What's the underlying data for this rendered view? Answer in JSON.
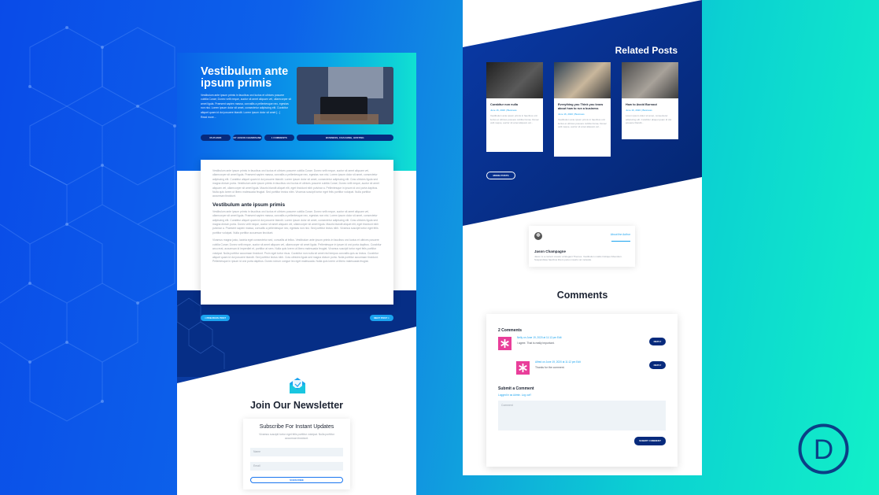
{
  "colors": {
    "brand_dark": "#072a7c",
    "accent_blue": "#1aa3ef",
    "pink_avatar": "#e93e9a",
    "divi_logo": "#0b3f86"
  },
  "left_page": {
    "hero": {
      "title": "Vestibulum ante ipsum primis",
      "text": "Vestibulum ante ipsum primis in faucibus orci luctus et ultrices posuere cubilia Curae; Donec velit neque, auctor sit amet aliquam vel, ullamcorper sit amet ligula. Praesent sapien massa, convallis a pellentesque nec, egestas non nisi. Lorem ipsum dolor sit amet, consectetur adipiscing elit. Curabitur aliquet quam id dui posuere blandit. Lorem ipsum dolor sit amet [...]",
      "read_more": "Read more..."
    },
    "meta": [
      "05.25.2020",
      "BY JASON CHAMPAGNE",
      "1 COMMENTS",
      "BUSINESS, COACHING, HOSTING"
    ],
    "article": {
      "para1": "Vestibulum ante ipsum primis in faucibus orci luctus et ultrices posuere cubilia Curae; Donec velit neque, auctor sit amet aliquam vel, ullamcorper sit amet ligula. Praesent sapien massa, convallis a pellentesque nec, egestas non nisi. Lorem ipsum dolor sit amet, consectetur adipiscing elit. Curabitur aliquet quam id dui posuere blandit. Lorem ipsum dolor sit amet, consectetur adipiscing elit. Cras ultricies ligula sed magna dictum porta. Vestibulum ante ipsum primis in faucibus orci luctus et ultrices posuere cubilia Curae; Donec velit neque, auctor sit amet aliquam vel, ullamcorper sit amet ligula. Mauris blandit aliquet elit, eget tincidunt nibh pulvinar a. Pellentesque in ipsum id orci porta dapibus. Nulla quis lorem ut libero malesuada feugiat. Sed porttitor lectus nibh. Vivamus suscipit tortor eget felis porttitor volutpat. Nulla porttitor accumsan tincidunt.",
      "subheading": "Vestibulum ante ipsum primis",
      "para2": "Vestibulum ante ipsum primis in faucibus orci luctus et ultrices posuere cubilia Curae; Donec velit neque, auctor sit amet aliquam vel, ullamcorper sit amet ligula. Praesent sapien massa, convallis a pellentesque nec, egestas non nisi. Lorem ipsum dolor sit amet, consectetur adipiscing elit. Curabitur aliquet quam id dui posuere blandit. Lorem ipsum dolor sit amet, consectetur adipiscing elit. Cras ultricies ligula sed magna dictum porta. Donec velit neque, auctor sit amet aliquam vel, ullamcorper sit amet ligula. Mauris blandit aliquet elit, eget tincidunt nibh pulvinar a. Praesent sapien massa, convallis a pellentesque nec, egestas non nisi. Sed porttitor lectus nibh. Vivamus suscipit tortor eget felis porttitor volutpat. Nulla porttitor accumsan tincidunt.",
      "para3": "Vivamus magna justo, lacinia eget consectetur sed, convallis at tellus. Vestibulum ante ipsum primis in faucibus orci luctus et ultrices posuere cubilia Curae; Donec velit neque, auctor sit amet aliquam vel, ullamcorper sit amet ligula. Pellentesque in ipsum id orci porta dapibus. Curabitur arcu erat, accumsan id imperdiet et, porttitor at sem. Nulla quis lorem ut libero malesuada feugiat. Vivamus suscipit tortor eget felis porttitor volutpat. Nulla porttitor accumsan tincidunt. Proin eget tortor risus. Curabitur non nulla sit amet nisl tempus convallis quis ac lectus. Curabitur aliquet quam id dui posuere blandit. Sed porttitor lectus nibh. Cras ultricies ligula sed magna dictum porta. Nulla porttitor accumsan tincidunt. Pellentesque in ipsum id orci porta dapibus. Donec rutrum congue leo eget malesuada. Nulla quis lorem ut libero malesuada feugiat."
    },
    "nav": {
      "prev": "< PREVIOUS POST",
      "next": "NEXT POST >"
    },
    "newsletter": {
      "title": "Join Our Newsletter",
      "card_title": "Subscribe For Instant Updates",
      "card_text": "Vivamus suscipit tortor eget felis porttitor volutpat. Nulla porttitor accumsan tincidunt.",
      "name_placeholder": "Name",
      "email_placeholder": "Email",
      "subscribe": "SUBSCRIBE"
    }
  },
  "right_page": {
    "related_title": "Related Posts",
    "posts": [
      {
        "title": "Curabitur non nulla",
        "meta": "June 16, 2020 | Business",
        "text": "Vestibulum ante ipsum primis in faucibus orci luctus et ultrices posuere cubilia Curae; Donec velit neque, auctor sit amet aliquam vel..."
      },
      {
        "title": "Everything you Think you know about how to run a business",
        "meta": "June 16, 2020 | Business",
        "text": "Vestibulum ante ipsum primis in faucibus orci luctus et ultrices posuere cubilia Curae; Donec velit neque, auctor sit amet aliquam vel..."
      },
      {
        "title": "How to Avoid Burnout",
        "meta": "June 16, 2020 | Business",
        "text": "Lorem ipsum dolor sit amet, consectetur adipiscing elit. Curabitur aliquet quam id dui posuere blandit..."
      }
    ],
    "more_posts": "MORE POSTS",
    "author": {
      "label": "About the Author",
      "name": "Jason Champagne",
      "bio": "Jason is a content creator at Elegant Themes. Vestibulum mattis tristique bibendum. Suspendisse faucibus libero purus mauris vel molestie."
    },
    "comments_title": "Comments",
    "comments_count": "2 Comments",
    "comments": [
      {
        "author": "Nelly on June 19, 2020 at 11:12 pm Edit",
        "text": "I agree. That is really important.",
        "reply": "REPLY"
      },
      {
        "author": "Alfred on June 19, 2020 at 11:12 pm Edit",
        "text": "Thanks for the comment.",
        "reply": "REPLY"
      }
    ],
    "submit": {
      "title": "Submit a Comment",
      "note": "Logged in as Admin. Log out?",
      "placeholder": "Comment",
      "button": "SUBMIT COMMENT"
    }
  },
  "logo": {
    "letter": "D"
  }
}
